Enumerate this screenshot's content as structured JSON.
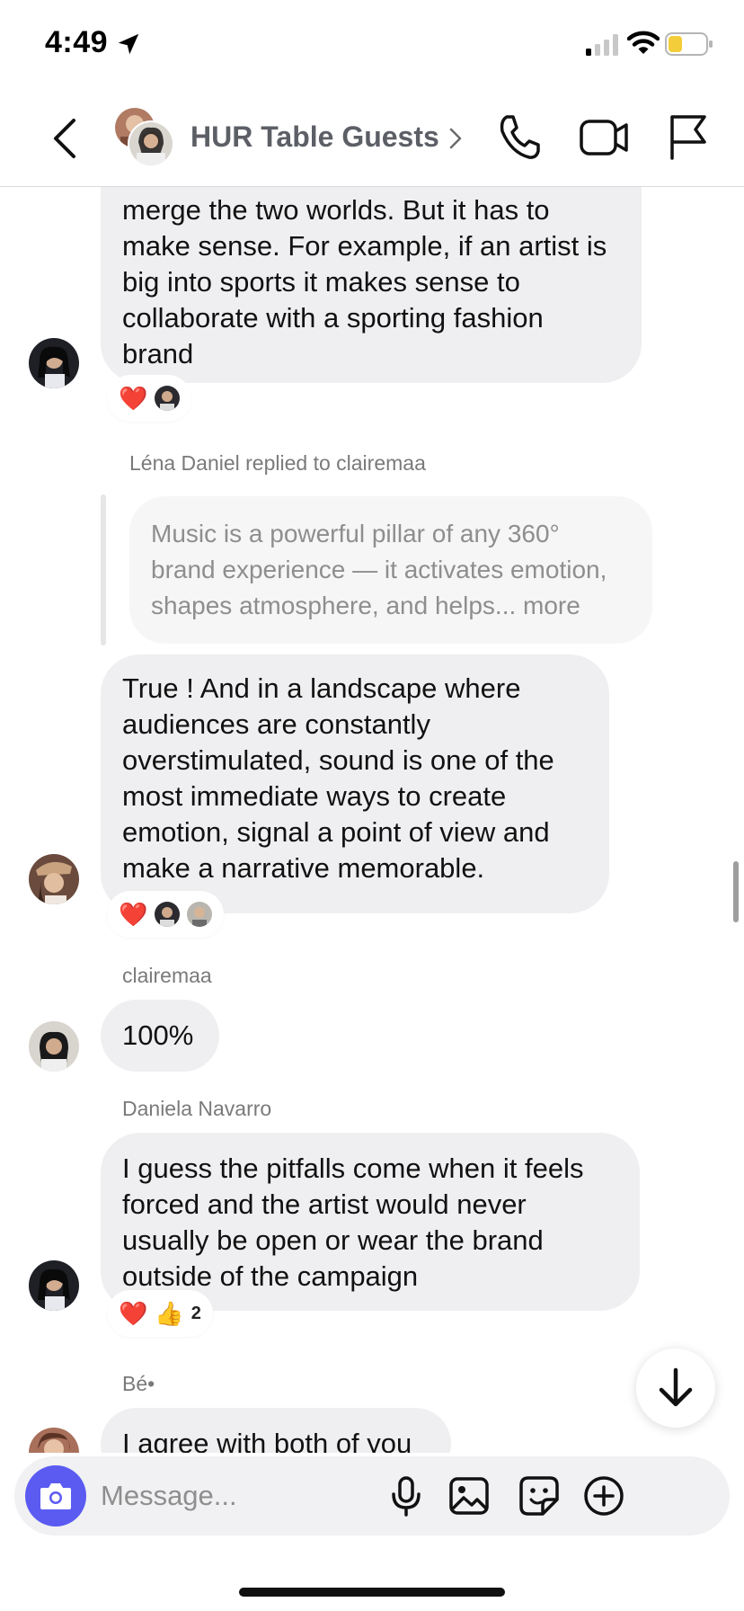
{
  "status_bar": {
    "time": "4:49",
    "battery_color": "#f4cd3a"
  },
  "header": {
    "title": "HUR Table Guests"
  },
  "messages": [
    {
      "id": "m1",
      "text": "merge the two worlds. But it has to make sense. For example, if an artist is big into sports it makes sense to collaborate with a sporting fashion brand",
      "reactions": [
        "❤️"
      ]
    },
    {
      "id": "m2",
      "reply_header": "Léna Daniel replied to clairemaa",
      "quoted": "Music is a powerful pillar of any 360° brand experience — it activates emotion, shapes atmosphere, and helps... more",
      "text": "True ! And in a landscape where audiences are constantly overstimulated, sound is one of the most immediate ways to create emotion, signal a point of view and make a narrative memorable.",
      "reactions": [
        "❤️"
      ]
    },
    {
      "id": "m3",
      "sender": "clairemaa",
      "text": "100%"
    },
    {
      "id": "m4",
      "sender": "Daniela Navarro",
      "text": "I guess the pitfalls come when it feels forced and the artist would never usually be open or wear the brand outside of the campaign",
      "reactions": [
        "❤️",
        "👍"
      ],
      "reaction_count": "2"
    },
    {
      "id": "m5",
      "sender": "Bé•",
      "text": "I agree with both of you"
    }
  ],
  "composer": {
    "placeholder": "Message...",
    "accent_color": "#5b5bf2"
  }
}
